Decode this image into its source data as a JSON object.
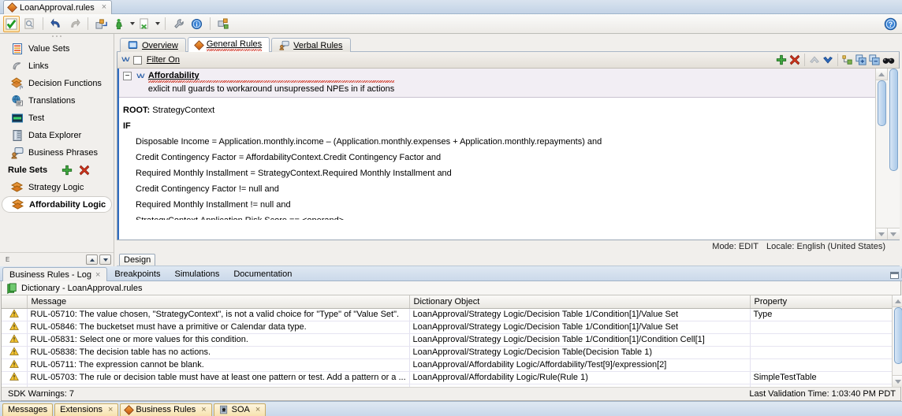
{
  "window": {
    "doc_tab": "LoanApproval.rules",
    "doc_tab_close": "×",
    "help_icon": "help-icon"
  },
  "toolbar": {
    "buttons": [
      {
        "name": "validate-button",
        "icon": "green-check-icon"
      },
      {
        "name": "preview-button",
        "icon": "magnifier-page-icon"
      },
      {
        "name": "undo-button",
        "icon": "undo-arrow-icon"
      },
      {
        "name": "redo-button",
        "icon": "redo-arrow-icon"
      },
      {
        "name": "deploy-button",
        "icon": "deploy-icon"
      },
      {
        "name": "run-button",
        "icon": "green-person-icon"
      },
      {
        "name": "stop-button",
        "icon": "page-stop-icon"
      },
      {
        "name": "tools-button",
        "icon": "wrench-icon"
      },
      {
        "name": "info-button",
        "icon": "info-icon"
      },
      {
        "name": "refactor-button",
        "icon": "refactor-icon"
      }
    ]
  },
  "sidebar": {
    "items": [
      {
        "label": "Value Sets",
        "icon": "value-sets-icon"
      },
      {
        "label": "Links",
        "icon": "links-icon"
      },
      {
        "label": "Decision Functions",
        "icon": "decision-functions-icon"
      },
      {
        "label": "Translations",
        "icon": "translations-icon"
      },
      {
        "label": "Test",
        "icon": "test-icon"
      },
      {
        "label": "Data Explorer",
        "icon": "data-explorer-icon"
      },
      {
        "label": "Business Phrases",
        "icon": "business-phrases-icon"
      }
    ],
    "rule_sets_header": "Rule Sets",
    "add_icon": "green-plus-icon",
    "delete_icon": "red-x-icon",
    "rule_sets": [
      {
        "label": "Strategy Logic",
        "selected": false
      },
      {
        "label": "Affordability Logic",
        "selected": true
      }
    ],
    "footer_label": "E"
  },
  "editor": {
    "tabs": [
      {
        "label": "Overview",
        "icon": "overview-icon",
        "active": false,
        "squiggle": false
      },
      {
        "label": "General Rules",
        "icon": "general-rules-icon",
        "active": true,
        "squiggle": true
      },
      {
        "label": "Verbal Rules",
        "icon": "verbal-rules-icon",
        "active": false,
        "squiggle": false
      }
    ],
    "filter": {
      "chevron_icon": "chevron-double-down-icon",
      "label": "Filter On",
      "checked": false
    },
    "filter_tools": [
      {
        "name": "add-rule-button",
        "icon": "green-plus-icon"
      },
      {
        "name": "delete-rule-button",
        "icon": "red-x-icon"
      },
      {
        "name": "move-up-button",
        "icon": "up-chevron-icon"
      },
      {
        "name": "move-down-button",
        "icon": "down-chevron-icon"
      },
      {
        "name": "expand-tree-button",
        "icon": "tree-expand-icon"
      },
      {
        "name": "expand-all-button",
        "icon": "expand-all-icon"
      },
      {
        "name": "collapse-all-button",
        "icon": "collapse-all-icon"
      },
      {
        "name": "show-advanced-button",
        "icon": "glasses-icon"
      }
    ],
    "rule": {
      "name": "Affordability",
      "description": "exlicit null guards to workaround unsupressed NPEs in if actions",
      "root_label": "ROOT:",
      "root_value": "StrategyContext",
      "if_label": "IF",
      "conditions": [
        "Disposable Income = Application.monthly.income – (Application.monthly.expenses + Application.monthly.repayments) and",
        "Credit Contingency Factor = AffordabilityContext.Credit Contingency Factor and",
        "Required Monthly Installment = StrategyContext.Required Monthly Installment and",
        "Credit Contingency Factor  !=  null and",
        "Required Monthly Installment  !=  null and",
        "StrategyContext.Application.Risk Score  ==   <operand>"
      ]
    },
    "mode_text": "Mode: EDIT",
    "locale_text": "Locale: English (United States)",
    "design_tab": "Design"
  },
  "dock": {
    "tabs": [
      {
        "label": "Business Rules - Log",
        "active": true,
        "closable": true
      },
      {
        "label": "Breakpoints",
        "active": false,
        "closable": false
      },
      {
        "label": "Simulations",
        "active": false,
        "closable": false
      },
      {
        "label": "Documentation",
        "active": false,
        "closable": false
      }
    ],
    "dictionary_title": "Dictionary - LoanApproval.rules",
    "dictionary_icon": "dictionary-icon",
    "columns": [
      "",
      "Message",
      "Dictionary Object",
      "Property"
    ],
    "rows": [
      {
        "icon": "warning-icon",
        "message": "RUL-05710: The value chosen, \"StrategyContext\", is not a valid choice for \"Type\" of \"Value Set\".",
        "object": "LoanApproval/Strategy Logic/Decision Table 1/Condition[1]/Value Set",
        "property": "Type"
      },
      {
        "icon": "warning-icon",
        "message": "RUL-05846: The bucketset must have a primitive or Calendar data type.",
        "object": "LoanApproval/Strategy Logic/Decision Table 1/Condition[1]/Value Set",
        "property": ""
      },
      {
        "icon": "warning-icon",
        "message": "RUL-05831: Select one or more values for this condition.",
        "object": "LoanApproval/Strategy Logic/Decision Table 1/Condition[1]/Condition Cell[1]",
        "property": ""
      },
      {
        "icon": "warning-icon",
        "message": "RUL-05838: The decision table has no actions.",
        "object": "LoanApproval/Strategy Logic/Decision Table(Decision Table 1)",
        "property": ""
      },
      {
        "icon": "warning-icon",
        "message": "RUL-05711: The expression cannot be blank.",
        "object": "LoanApproval/Affordability Logic/Affordability/Test[9]/expression[2]",
        "property": ""
      },
      {
        "icon": "warning-icon",
        "message": "RUL-05703: The rule or decision table must have at least one pattern or test.  Add a pattern or a ...",
        "object": "LoanApproval/Affordability Logic/Rule(Rule 1)",
        "property": "SimpleTestTable"
      }
    ],
    "status_left": "SDK Warnings: 7",
    "status_right": "Last Validation Time: 1:03:40 PM PDT"
  },
  "bottombar": {
    "tabs": [
      {
        "label": "Messages",
        "icon": null,
        "closable": false
      },
      {
        "label": "Extensions",
        "icon": null,
        "closable": true
      },
      {
        "label": "Business Rules",
        "icon": "diamond-icon",
        "closable": true
      },
      {
        "label": "SOA",
        "icon": "soa-icon",
        "closable": true
      }
    ]
  },
  "colors": {
    "accent_blue": "#2f6cc0",
    "warning_yellow": "#f0c020",
    "tab_gold": "#f7e2ae",
    "rule_header_bg": "#f2eef4"
  }
}
